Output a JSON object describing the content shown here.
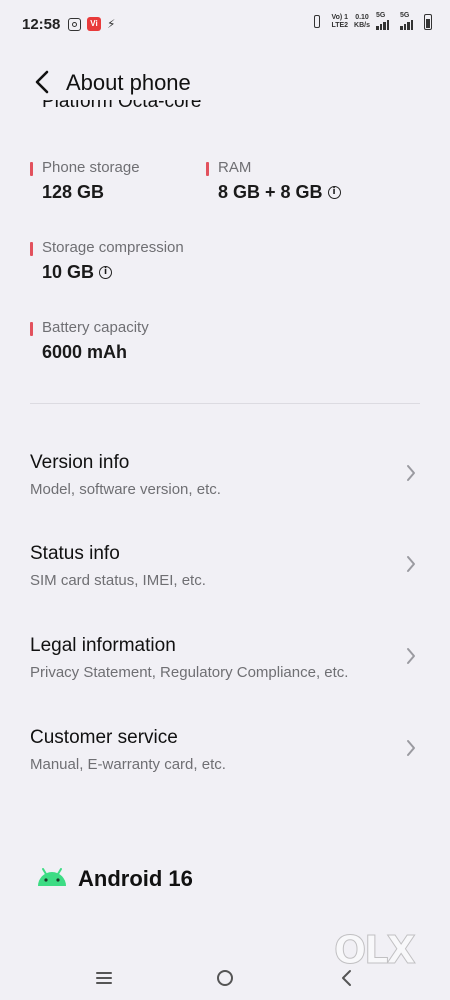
{
  "status_bar": {
    "time": "12:58",
    "network_top": "Vo) 1",
    "network_bottom": "LTE2",
    "speed_top": "0.10",
    "speed_bottom": "KB/s",
    "sim1": "5G",
    "sim2": "5G",
    "app_badge": "Vi"
  },
  "header": {
    "title": "About phone",
    "partial_text": "Platform Octa-core"
  },
  "specs": [
    {
      "label": "Phone storage",
      "value": "128 GB",
      "info": false
    },
    {
      "label": "RAM",
      "value": "8 GB + 8 GB",
      "info": true
    },
    {
      "label": "Storage compression",
      "value": "10 GB",
      "info": true
    },
    {
      "label": "Battery capacity",
      "value": "6000 mAh",
      "info": false
    }
  ],
  "menu": [
    {
      "title": "Version info",
      "subtitle": "Model, software version, etc."
    },
    {
      "title": "Status info",
      "subtitle": "SIM card status, IMEI, etc."
    },
    {
      "title": "Legal information",
      "subtitle": "Privacy Statement, Regulatory Compliance, etc."
    },
    {
      "title": "Customer service",
      "subtitle": "Manual, E-warranty card, etc."
    }
  ],
  "android": {
    "label": "Android 16"
  },
  "watermark": "OLX",
  "icons": {
    "back": "back-arrow-icon",
    "chevron": "chevron-right-icon",
    "android": "android-logo-icon",
    "nav_menu": "recent-apps-icon",
    "nav_home": "home-icon",
    "nav_back": "back-icon"
  },
  "colors": {
    "background": "#f1f0f5",
    "accent_marker": "#e2515d",
    "android_green": "#3ddc84"
  }
}
